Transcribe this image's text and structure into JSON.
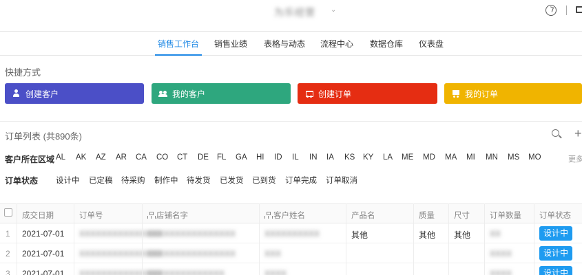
{
  "topbar": {
    "app_title": "为乐经营",
    "caret": "⌄"
  },
  "nav": {
    "tabs": [
      "销售工作台",
      "销售业绩",
      "表格与动态",
      "流程中心",
      "数据仓库",
      "仪表盘"
    ],
    "active": "销售工作台"
  },
  "shortcuts": {
    "title": "快捷方式",
    "buttons": [
      {
        "label": "创建客户",
        "icon": "user-plus-icon",
        "color": "#4b4fc7"
      },
      {
        "label": "我的客户",
        "icon": "users-icon",
        "color": "#2ea77e"
      },
      {
        "label": "创建订单",
        "icon": "cart-icon",
        "color": "#e52d12"
      },
      {
        "label": "我的订单",
        "icon": "cart-icon",
        "color": "#f0b400"
      }
    ]
  },
  "orders": {
    "title": "订单列表 (共890条)",
    "search_icon": "search-icon",
    "add_icon": "+",
    "region_filter": {
      "label": "客户所在区域",
      "options": [
        "AL",
        "AK",
        "AZ",
        "AR",
        "CA",
        "CO",
        "CT",
        "DE",
        "FL",
        "GA",
        "HI",
        "ID",
        "IL",
        "IN",
        "IA",
        "KS",
        "KY",
        "LA",
        "ME",
        "MD",
        "MA",
        "MI",
        "MN",
        "MS",
        "MO"
      ],
      "more": "更多"
    },
    "status_filter": {
      "label": "订单状态",
      "options": [
        "设计中",
        "已定稿",
        "待采购",
        "制作中",
        "待发货",
        "已发货",
        "已到货",
        "订单完成",
        "订单取消"
      ]
    },
    "columns": [
      "成交日期",
      "订单号",
      "店铺名字",
      "客户姓名",
      "产品名",
      "质量",
      "尺寸",
      "订单数量",
      "订单状态"
    ],
    "rows": [
      {
        "num": "1",
        "date": "2021-07-01",
        "order_no": "XXXXXXXXXXXXXXX",
        "shop": "XXXXXXXXXXXXXXXX",
        "customer": "XXXXXXXXXX",
        "product": "其他",
        "quality": "其他",
        "size": "其他",
        "qty": "XX",
        "status": "设计中"
      },
      {
        "num": "2",
        "date": "2021-07-01",
        "order_no": "XXXXXXXXXXXXXXX",
        "shop": "XXXXXXXXXXXXXXXX",
        "customer": "XXX",
        "product": "",
        "quality": "",
        "size": "",
        "qty": "XXXX",
        "status": "设计中"
      },
      {
        "num": "3",
        "date": "2021-07-01",
        "order_no": "XXXXXXXXXXXXXXX",
        "shop": "XXXXXXXXXXXXXX",
        "customer": "XXXX",
        "product": "",
        "quality": "",
        "size": "",
        "qty": "XXXX",
        "status": "设计中"
      }
    ]
  }
}
